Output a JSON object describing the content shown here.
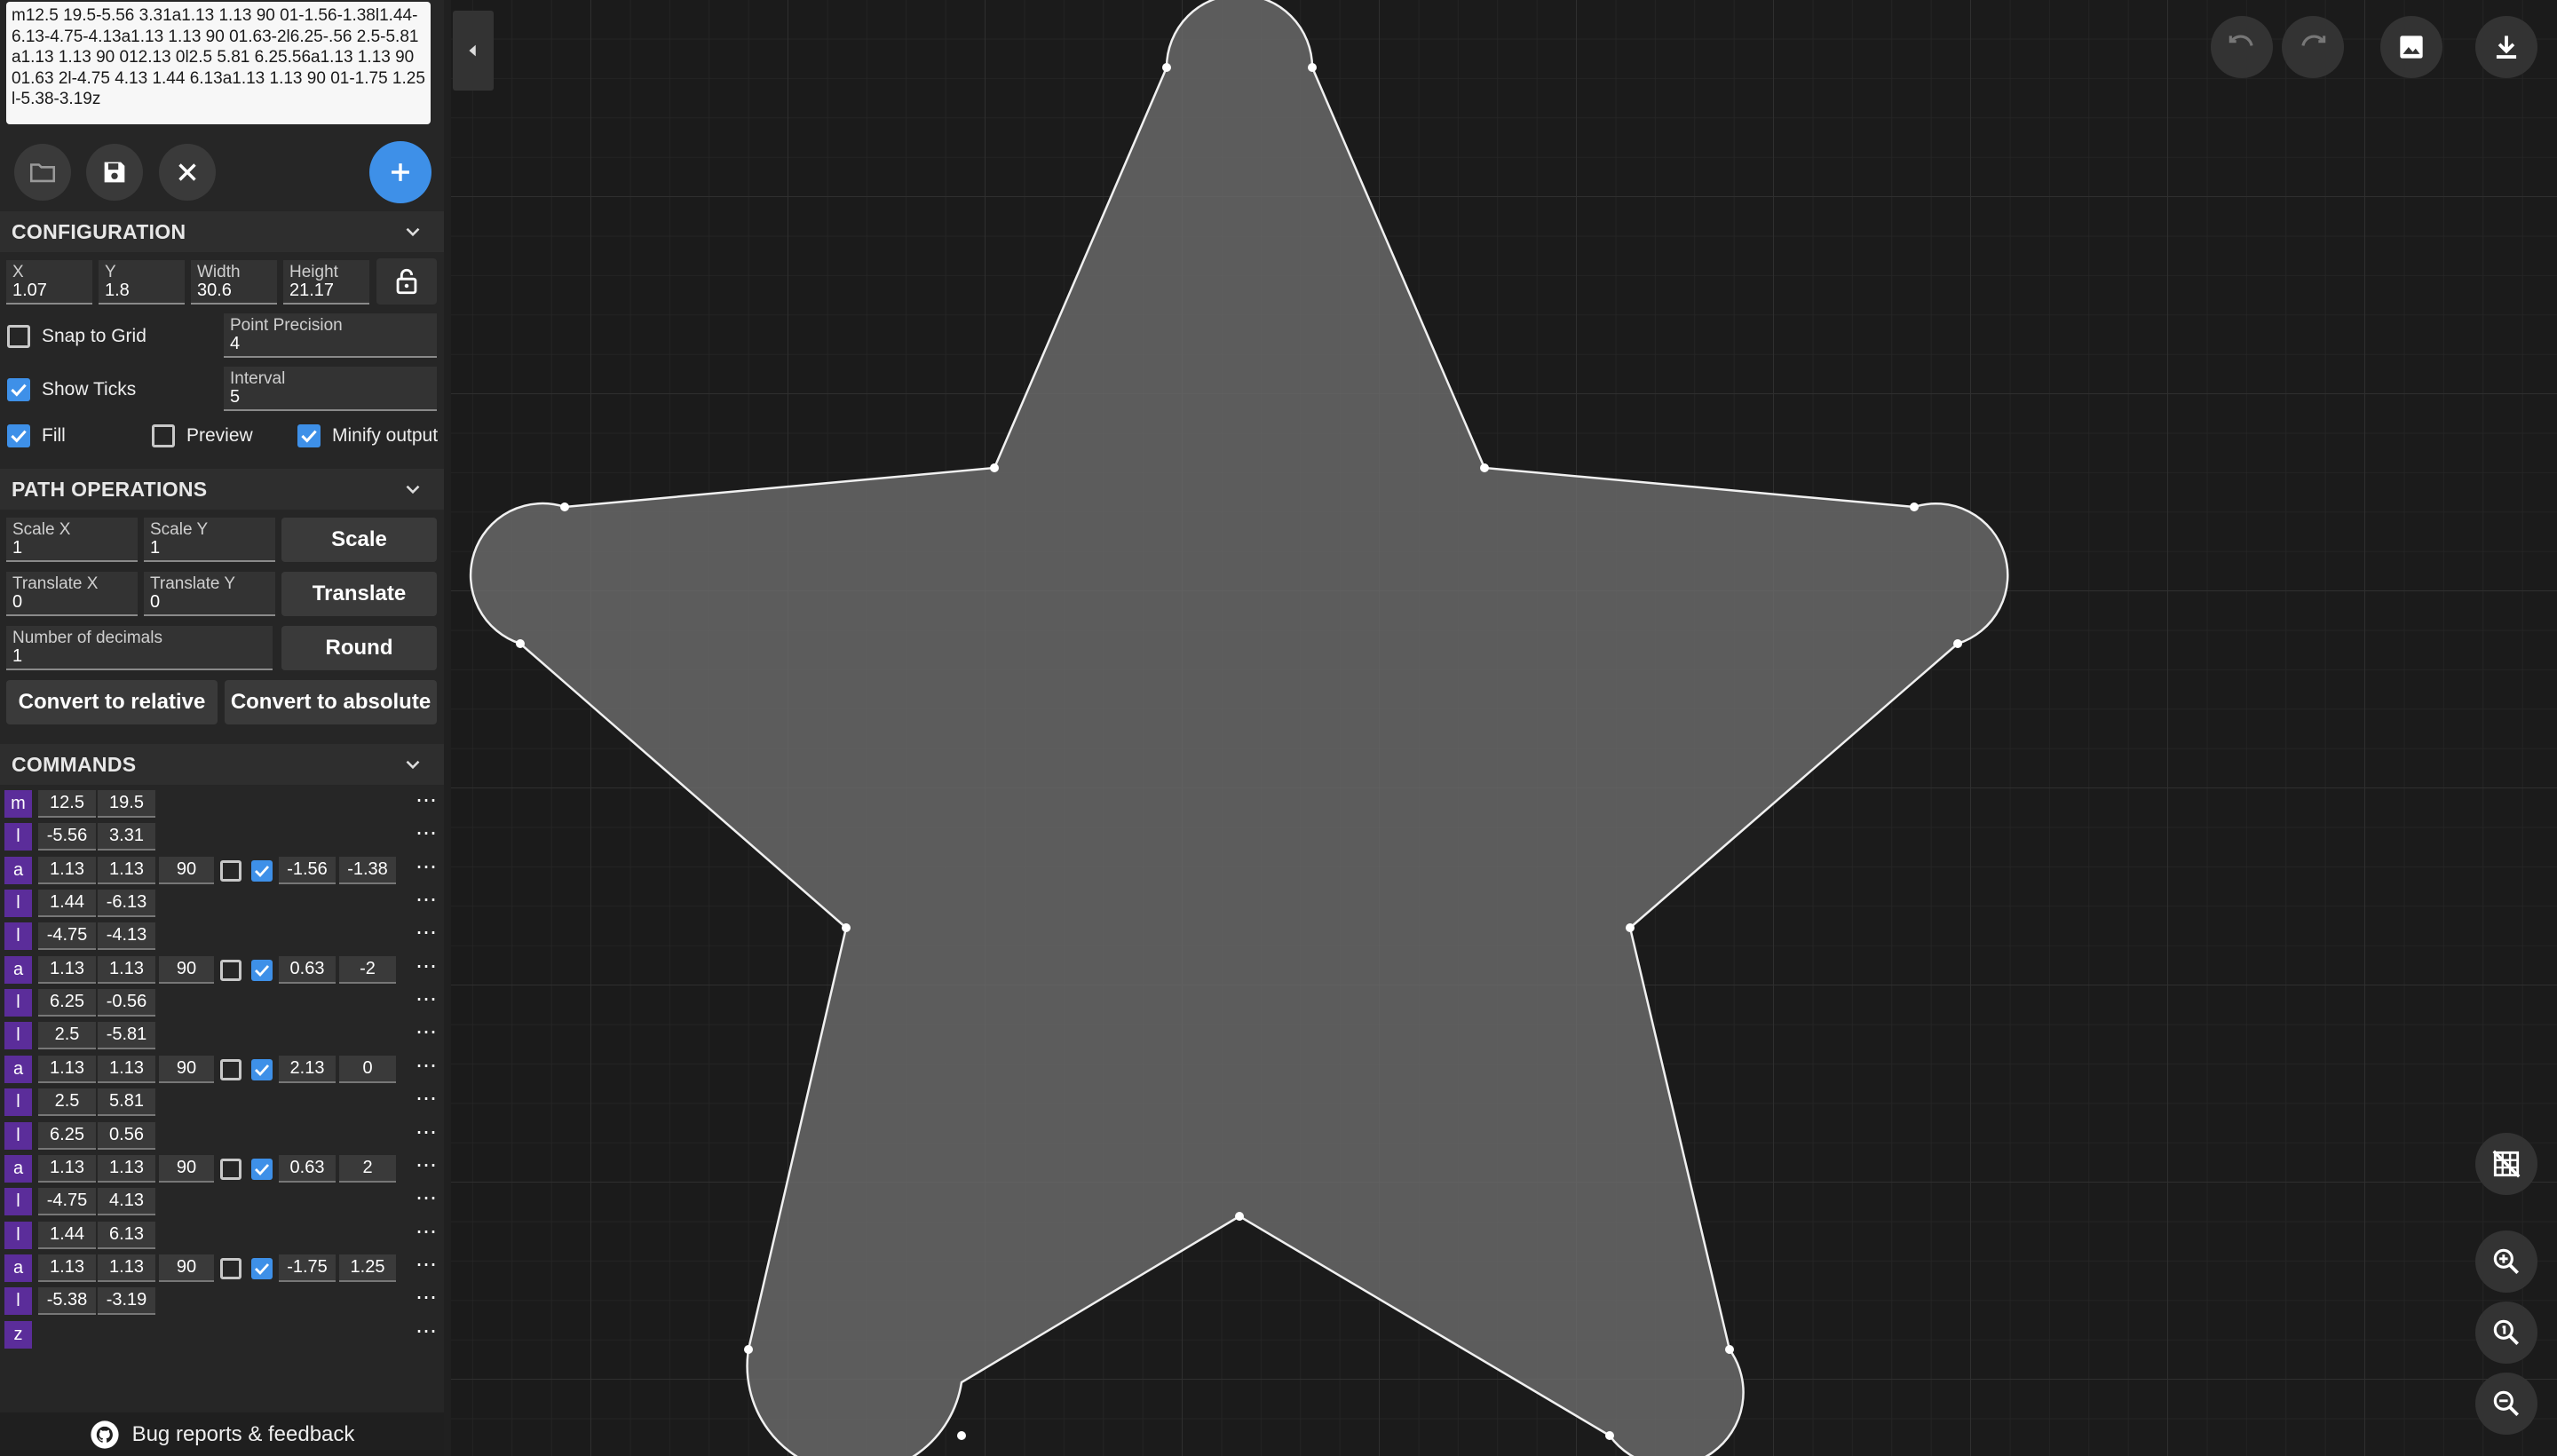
{
  "path_text": "m12.5 19.5-5.56 3.31a1.13 1.13 90 01-1.56-1.38l1.44-6.13-4.75-4.13a1.13 1.13 90 01.63-2l6.25-.56 2.5-5.81a1.13 1.13 90 012.13 0l2.5 5.81 6.25.56a1.13 1.13 90 01.63 2l-4.75 4.13 1.44 6.13a1.13 1.13 90 01-1.75 1.25l-5.38-3.19z",
  "toolbar": {
    "open_icon": "folder-icon",
    "save_icon": "save-icon",
    "clear_icon": "close-icon",
    "add_icon": "plus-icon"
  },
  "configuration": {
    "title": "CONFIGURATION",
    "x_label": "X",
    "x": "1.07",
    "y_label": "Y",
    "y": "1.8",
    "width_label": "Width",
    "width": "30.6",
    "height_label": "Height",
    "height": "21.17",
    "snap_label": "Snap to Grid",
    "snap_checked": false,
    "precision_label": "Point Precision",
    "precision": "4",
    "ticks_label": "Show Ticks",
    "ticks_checked": true,
    "interval_label": "Interval",
    "interval": "5",
    "fill_label": "Fill",
    "fill_checked": true,
    "preview_label": "Preview",
    "preview_checked": false,
    "minify_label": "Minify output",
    "minify_checked": true
  },
  "path_operations": {
    "title": "PATH OPERATIONS",
    "scale_x_label": "Scale X",
    "scale_x": "1",
    "scale_y_label": "Scale Y",
    "scale_y": "1",
    "scale_button": "Scale",
    "translate_x_label": "Translate X",
    "translate_x": "0",
    "translate_y_label": "Translate Y",
    "translate_y": "0",
    "translate_button": "Translate",
    "decimals_label": "Number of decimals",
    "decimals": "1",
    "round_button": "Round",
    "relative_button": "Convert to relative",
    "absolute_button": "Convert to absolute"
  },
  "commands": {
    "title": "COMMANDS",
    "more": "⋯",
    "rows": [
      {
        "cmd": "m",
        "values": [
          "12.5",
          "19.5"
        ]
      },
      {
        "cmd": "l",
        "values": [
          "-5.56",
          "3.31"
        ]
      },
      {
        "cmd": "a",
        "values": [
          "1.13",
          "1.13",
          "90"
        ],
        "large_arc": false,
        "sweep": true,
        "end": [
          "-1.56",
          "-1.38"
        ]
      },
      {
        "cmd": "l",
        "values": [
          "1.44",
          "-6.13"
        ]
      },
      {
        "cmd": "l",
        "values": [
          "-4.75",
          "-4.13"
        ]
      },
      {
        "cmd": "a",
        "values": [
          "1.13",
          "1.13",
          "90"
        ],
        "large_arc": false,
        "sweep": true,
        "end": [
          "0.63",
          "-2"
        ]
      },
      {
        "cmd": "l",
        "values": [
          "6.25",
          "-0.56"
        ]
      },
      {
        "cmd": "l",
        "values": [
          "2.5",
          "-5.81"
        ]
      },
      {
        "cmd": "a",
        "values": [
          "1.13",
          "1.13",
          "90"
        ],
        "large_arc": false,
        "sweep": true,
        "end": [
          "2.13",
          "0"
        ]
      },
      {
        "cmd": "l",
        "values": [
          "2.5",
          "5.81"
        ]
      },
      {
        "cmd": "l",
        "values": [
          "6.25",
          "0.56"
        ]
      },
      {
        "cmd": "a",
        "values": [
          "1.13",
          "1.13",
          "90"
        ],
        "large_arc": false,
        "sweep": true,
        "end": [
          "0.63",
          "2"
        ]
      },
      {
        "cmd": "l",
        "values": [
          "-4.75",
          "4.13"
        ]
      },
      {
        "cmd": "l",
        "values": [
          "1.44",
          "6.13"
        ]
      },
      {
        "cmd": "a",
        "values": [
          "1.13",
          "1.13",
          "90"
        ],
        "large_arc": false,
        "sweep": true,
        "end": [
          "-1.75",
          "1.25"
        ]
      },
      {
        "cmd": "l",
        "values": [
          "-5.38",
          "-3.19"
        ]
      },
      {
        "cmd": "z",
        "values": []
      }
    ]
  },
  "footer": {
    "icon": "github-icon",
    "text": "Bug reports & feedback"
  },
  "canvas_tools": {
    "undo_icon": "undo-icon",
    "redo_icon": "redo-icon",
    "image_icon": "image-icon",
    "download_icon": "download-icon",
    "grid_toggle_icon": "grid-off-icon",
    "zoom_in_icon": "zoom-in-icon",
    "zoom_fit_icon": "zoom-reset-icon",
    "zoom_out_icon": "zoom-out-icon"
  },
  "colors": {
    "accent": "#3e90e8",
    "command_badge": "#5b2d9a",
    "shape_fill": "#5a5a5a",
    "canvas_bg": "#1b1b1b",
    "panel_bg": "#262626"
  }
}
